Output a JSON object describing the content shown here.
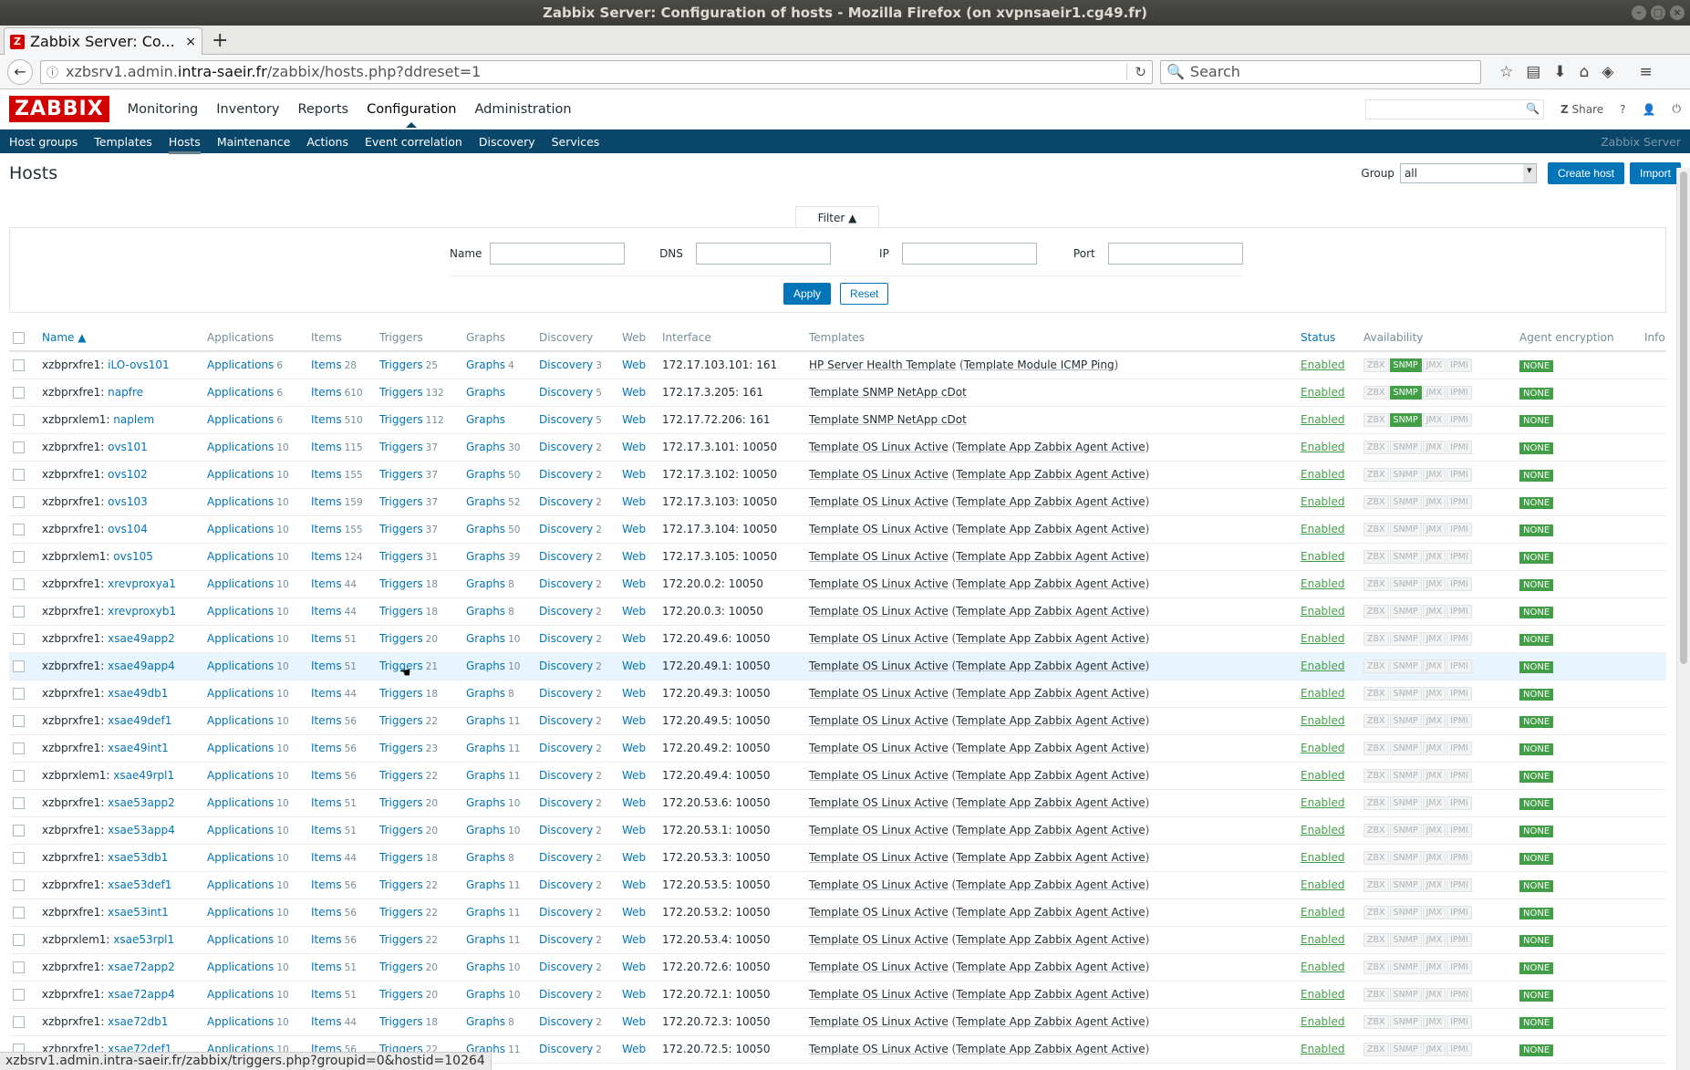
{
  "window": {
    "title": "Zabbix Server: Configuration of hosts - Mozilla Firefox (on xvpnsaeir1.cg49.fr)"
  },
  "browser": {
    "tab_title": "Zabbix Server: Co...",
    "url_pre": "xzbsrv1.admin.",
    "url_domain": "intra-saeir.fr",
    "url_post": "/zabbix/hosts.php?ddreset=1",
    "search_placeholder": "Search",
    "status_url": "xzbsrv1.admin.intra-saeir.fr/zabbix/triggers.php?groupid=0&hostid=10264"
  },
  "header": {
    "logo": "ZABBIX",
    "menu": [
      "Monitoring",
      "Inventory",
      "Reports",
      "Configuration",
      "Administration"
    ],
    "share": "Share",
    "help": "?"
  },
  "submenu": {
    "items": [
      "Host groups",
      "Templates",
      "Hosts",
      "Maintenance",
      "Actions",
      "Event correlation",
      "Discovery",
      "Services"
    ],
    "server": "Zabbix Server"
  },
  "page": {
    "title": "Hosts",
    "group_label": "Group",
    "group_value": "all",
    "create_host": "Create host",
    "import": "Import"
  },
  "filter": {
    "tab": "Filter ▲",
    "name_label": "Name",
    "dns_label": "DNS",
    "ip_label": "IP",
    "port_label": "Port",
    "apply": "Apply",
    "reset": "Reset"
  },
  "table": {
    "headers": [
      "Name ▲",
      "Applications",
      "Items",
      "Triggers",
      "Graphs",
      "Discovery",
      "Web",
      "Interface",
      "Templates",
      "Status",
      "Availability",
      "Agent encryption",
      "Info"
    ],
    "link_labels": {
      "applications": "Applications",
      "items": "Items",
      "triggers": "Triggers",
      "graphs": "Graphs",
      "discovery": "Discovery",
      "web": "Web"
    },
    "availability_labels": [
      "ZBX",
      "SNMP",
      "JMX",
      "IPMI"
    ],
    "rows": [
      {
        "proxy": "xzbprxfre1:",
        "name": "iLO-ovs101",
        "apps": "6",
        "items": "28",
        "triggers": "25",
        "graphs": "4",
        "disc": "3",
        "iface": "172.17.103.101: 161",
        "tpl": "HP Server Health Template",
        "tplsub": "Template Module ICMP Ping",
        "status": "Enabled",
        "snmp": true,
        "enc": "NONE"
      },
      {
        "proxy": "xzbprxfre1:",
        "name": "napfre",
        "apps": "6",
        "items": "610",
        "triggers": "132",
        "graphs": "",
        "disc": "5",
        "iface": "172.17.3.205: 161",
        "tpl": "Template SNMP NetApp cDot",
        "tplsub": "",
        "status": "Enabled",
        "snmp": true,
        "enc": "NONE"
      },
      {
        "proxy": "xzbprxlem1:",
        "name": "naplem",
        "apps": "6",
        "items": "510",
        "triggers": "112",
        "graphs": "",
        "disc": "5",
        "iface": "172.17.72.206: 161",
        "tpl": "Template SNMP NetApp cDot",
        "tplsub": "",
        "status": "Enabled",
        "snmp": true,
        "enc": "NONE"
      },
      {
        "proxy": "xzbprxfre1:",
        "name": "ovs101",
        "apps": "10",
        "items": "115",
        "triggers": "37",
        "graphs": "30",
        "disc": "2",
        "iface": "172.17.3.101: 10050",
        "tpl": "Template OS Linux Active",
        "tplsub": "Template App Zabbix Agent Active",
        "status": "Enabled",
        "snmp": false,
        "enc": "NONE"
      },
      {
        "proxy": "xzbprxfre1:",
        "name": "ovs102",
        "apps": "10",
        "items": "155",
        "triggers": "37",
        "graphs": "50",
        "disc": "2",
        "iface": "172.17.3.102: 10050",
        "tpl": "Template OS Linux Active",
        "tplsub": "Template App Zabbix Agent Active",
        "status": "Enabled",
        "snmp": false,
        "enc": "NONE"
      },
      {
        "proxy": "xzbprxfre1:",
        "name": "ovs103",
        "apps": "10",
        "items": "159",
        "triggers": "37",
        "graphs": "52",
        "disc": "2",
        "iface": "172.17.3.103: 10050",
        "tpl": "Template OS Linux Active",
        "tplsub": "Template App Zabbix Agent Active",
        "status": "Enabled",
        "snmp": false,
        "enc": "NONE"
      },
      {
        "proxy": "xzbprxfre1:",
        "name": "ovs104",
        "apps": "10",
        "items": "155",
        "triggers": "37",
        "graphs": "50",
        "disc": "2",
        "iface": "172.17.3.104: 10050",
        "tpl": "Template OS Linux Active",
        "tplsub": "Template App Zabbix Agent Active",
        "status": "Enabled",
        "snmp": false,
        "enc": "NONE"
      },
      {
        "proxy": "xzbprxlem1:",
        "name": "ovs105",
        "apps": "10",
        "items": "124",
        "triggers": "31",
        "graphs": "39",
        "disc": "2",
        "iface": "172.17.3.105: 10050",
        "tpl": "Template OS Linux Active",
        "tplsub": "Template App Zabbix Agent Active",
        "status": "Enabled",
        "snmp": false,
        "enc": "NONE"
      },
      {
        "proxy": "xzbprxfre1:",
        "name": "xrevproxya1",
        "apps": "10",
        "items": "44",
        "triggers": "18",
        "graphs": "8",
        "disc": "2",
        "iface": "172.20.0.2: 10050",
        "tpl": "Template OS Linux Active",
        "tplsub": "Template App Zabbix Agent Active",
        "status": "Enabled",
        "snmp": false,
        "enc": "NONE"
      },
      {
        "proxy": "xzbprxfre1:",
        "name": "xrevproxyb1",
        "apps": "10",
        "items": "44",
        "triggers": "18",
        "graphs": "8",
        "disc": "2",
        "iface": "172.20.0.3: 10050",
        "tpl": "Template OS Linux Active",
        "tplsub": "Template App Zabbix Agent Active",
        "status": "Enabled",
        "snmp": false,
        "enc": "NONE"
      },
      {
        "proxy": "xzbprxfre1:",
        "name": "xsae49app2",
        "apps": "10",
        "items": "51",
        "triggers": "20",
        "graphs": "10",
        "disc": "2",
        "iface": "172.20.49.6: 10050",
        "tpl": "Template OS Linux Active",
        "tplsub": "Template App Zabbix Agent Active",
        "status": "Enabled",
        "snmp": false,
        "enc": "NONE"
      },
      {
        "proxy": "xzbprxfre1:",
        "name": "xsae49app4",
        "apps": "10",
        "items": "51",
        "triggers": "21",
        "graphs": "10",
        "disc": "2",
        "iface": "172.20.49.1: 10050",
        "tpl": "Template OS Linux Active",
        "tplsub": "Template App Zabbix Agent Active",
        "status": "Enabled",
        "snmp": false,
        "enc": "NONE",
        "hl": true
      },
      {
        "proxy": "xzbprxfre1:",
        "name": "xsae49db1",
        "apps": "10",
        "items": "44",
        "triggers": "18",
        "graphs": "8",
        "disc": "2",
        "iface": "172.20.49.3: 10050",
        "tpl": "Template OS Linux Active",
        "tplsub": "Template App Zabbix Agent Active",
        "status": "Enabled",
        "snmp": false,
        "enc": "NONE"
      },
      {
        "proxy": "xzbprxfre1:",
        "name": "xsae49def1",
        "apps": "10",
        "items": "56",
        "triggers": "22",
        "graphs": "11",
        "disc": "2",
        "iface": "172.20.49.5: 10050",
        "tpl": "Template OS Linux Active",
        "tplsub": "Template App Zabbix Agent Active",
        "status": "Enabled",
        "snmp": false,
        "enc": "NONE"
      },
      {
        "proxy": "xzbprxfre1:",
        "name": "xsae49int1",
        "apps": "10",
        "items": "56",
        "triggers": "23",
        "graphs": "11",
        "disc": "2",
        "iface": "172.20.49.2: 10050",
        "tpl": "Template OS Linux Active",
        "tplsub": "Template App Zabbix Agent Active",
        "status": "Enabled",
        "snmp": false,
        "enc": "NONE"
      },
      {
        "proxy": "xzbprxlem1:",
        "name": "xsae49rpl1",
        "apps": "10",
        "items": "56",
        "triggers": "22",
        "graphs": "11",
        "disc": "2",
        "iface": "172.20.49.4: 10050",
        "tpl": "Template OS Linux Active",
        "tplsub": "Template App Zabbix Agent Active",
        "status": "Enabled",
        "snmp": false,
        "enc": "NONE"
      },
      {
        "proxy": "xzbprxfre1:",
        "name": "xsae53app2",
        "apps": "10",
        "items": "51",
        "triggers": "20",
        "graphs": "10",
        "disc": "2",
        "iface": "172.20.53.6: 10050",
        "tpl": "Template OS Linux Active",
        "tplsub": "Template App Zabbix Agent Active",
        "status": "Enabled",
        "snmp": false,
        "enc": "NONE"
      },
      {
        "proxy": "xzbprxfre1:",
        "name": "xsae53app4",
        "apps": "10",
        "items": "51",
        "triggers": "20",
        "graphs": "10",
        "disc": "2",
        "iface": "172.20.53.1: 10050",
        "tpl": "Template OS Linux Active",
        "tplsub": "Template App Zabbix Agent Active",
        "status": "Enabled",
        "snmp": false,
        "enc": "NONE"
      },
      {
        "proxy": "xzbprxfre1:",
        "name": "xsae53db1",
        "apps": "10",
        "items": "44",
        "triggers": "18",
        "graphs": "8",
        "disc": "2",
        "iface": "172.20.53.3: 10050",
        "tpl": "Template OS Linux Active",
        "tplsub": "Template App Zabbix Agent Active",
        "status": "Enabled",
        "snmp": false,
        "enc": "NONE"
      },
      {
        "proxy": "xzbprxfre1:",
        "name": "xsae53def1",
        "apps": "10",
        "items": "56",
        "triggers": "22",
        "graphs": "11",
        "disc": "2",
        "iface": "172.20.53.5: 10050",
        "tpl": "Template OS Linux Active",
        "tplsub": "Template App Zabbix Agent Active",
        "status": "Enabled",
        "snmp": false,
        "enc": "NONE"
      },
      {
        "proxy": "xzbprxfre1:",
        "name": "xsae53int1",
        "apps": "10",
        "items": "56",
        "triggers": "22",
        "graphs": "11",
        "disc": "2",
        "iface": "172.20.53.2: 10050",
        "tpl": "Template OS Linux Active",
        "tplsub": "Template App Zabbix Agent Active",
        "status": "Enabled",
        "snmp": false,
        "enc": "NONE"
      },
      {
        "proxy": "xzbprxlem1:",
        "name": "xsae53rpl1",
        "apps": "10",
        "items": "56",
        "triggers": "22",
        "graphs": "11",
        "disc": "2",
        "iface": "172.20.53.4: 10050",
        "tpl": "Template OS Linux Active",
        "tplsub": "Template App Zabbix Agent Active",
        "status": "Enabled",
        "snmp": false,
        "enc": "NONE"
      },
      {
        "proxy": "xzbprxfre1:",
        "name": "xsae72app2",
        "apps": "10",
        "items": "51",
        "triggers": "20",
        "graphs": "10",
        "disc": "2",
        "iface": "172.20.72.6: 10050",
        "tpl": "Template OS Linux Active",
        "tplsub": "Template App Zabbix Agent Active",
        "status": "Enabled",
        "snmp": false,
        "enc": "NONE"
      },
      {
        "proxy": "xzbprxfre1:",
        "name": "xsae72app4",
        "apps": "10",
        "items": "51",
        "triggers": "20",
        "graphs": "10",
        "disc": "2",
        "iface": "172.20.72.1: 10050",
        "tpl": "Template OS Linux Active",
        "tplsub": "Template App Zabbix Agent Active",
        "status": "Enabled",
        "snmp": false,
        "enc": "NONE"
      },
      {
        "proxy": "xzbprxfre1:",
        "name": "xsae72db1",
        "apps": "10",
        "items": "44",
        "triggers": "18",
        "graphs": "8",
        "disc": "2",
        "iface": "172.20.72.3: 10050",
        "tpl": "Template OS Linux Active",
        "tplsub": "Template App Zabbix Agent Active",
        "status": "Enabled",
        "snmp": false,
        "enc": "NONE"
      },
      {
        "proxy": "xzbprxfre1:",
        "name": "xsae72def1",
        "apps": "10",
        "items": "56",
        "triggers": "22",
        "graphs": "11",
        "disc": "2",
        "iface": "172.20.72.5: 10050",
        "tpl": "Template OS Linux Active",
        "tplsub": "Template App Zabbix Agent Active",
        "status": "Enabled",
        "snmp": false,
        "enc": "NONE"
      }
    ]
  }
}
